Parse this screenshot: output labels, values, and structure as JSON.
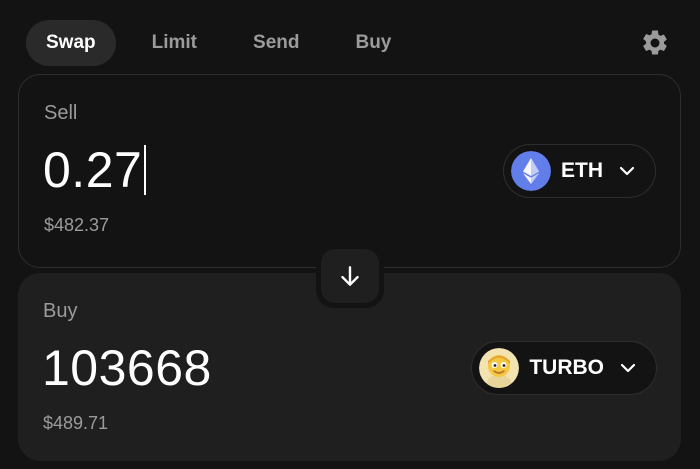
{
  "tabs": [
    {
      "label": "Swap",
      "active": true
    },
    {
      "label": "Limit",
      "active": false
    },
    {
      "label": "Send",
      "active": false
    },
    {
      "label": "Buy",
      "active": false
    }
  ],
  "settings_icon": "gear-icon",
  "sell": {
    "label": "Sell",
    "amount": "0.27",
    "usd_value": "$482.37",
    "token": {
      "symbol": "ETH",
      "icon": "eth-logo-icon",
      "color": "#627EEA"
    }
  },
  "switch_icon": "arrow-down-icon",
  "buy": {
    "label": "Buy",
    "amount": "103668",
    "usd_value": "$489.71",
    "token": {
      "symbol": "TURBO",
      "icon": "turbo-logo-icon",
      "color": "#F5D36B"
    }
  },
  "colors": {
    "background": "#131313",
    "panel": "#1F1F1F",
    "muted_text": "#9B9B9B",
    "border": "#2E2E2E"
  }
}
